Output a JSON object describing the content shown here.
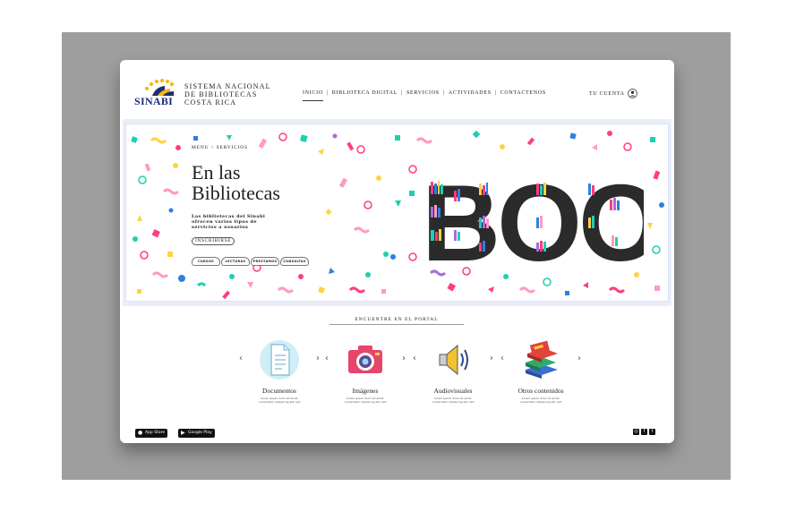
{
  "header": {
    "logo_text": "SINABI",
    "brand_lines": [
      "SISTEMA NACIONAL",
      "DE BIBLIOTECAS",
      "COSTA RICA"
    ],
    "nav": [
      "INICIO",
      "BIBLIOTECA DIGITAL",
      "SERVICIOS",
      "ACTIVIDADES",
      "CONTACTENOS"
    ],
    "nav_separators": [
      "|",
      "|",
      "|",
      "|"
    ],
    "account_label": "TU CUENTA",
    "icons": {
      "account": "user-icon",
      "logo": "sinabi-logo"
    }
  },
  "hero": {
    "breadcrumb": "MENU > SERVICIOS",
    "title_line1": "En las",
    "title_line2": "Bibliotecas",
    "description": "Las bibliotecas del Sinabi ofrecen varios tipos de servicios a usuarios",
    "subscribe_label": "INSCRIBIRSE",
    "pills": [
      "CURSOS",
      "LECTURAS",
      "PRESTAMOS",
      "CONSULTAS"
    ],
    "book_word": "BOOK",
    "colors": {
      "accent_pink": "#ff3d7f",
      "accent_teal": "#1ecfb0",
      "accent_blue": "#2f7fe0",
      "accent_yellow": "#ffd23f",
      "accent_purple": "#a86be0"
    }
  },
  "portal": {
    "title": "ENCUENTRE EN EL PORTAL",
    "items": [
      {
        "title": "Documentos",
        "desc1": "Lorem ipsum dolor sit amet,",
        "desc2": "consectetur adipiscing elit, sed",
        "icon": "document-icon"
      },
      {
        "title": "Imágenes",
        "desc1": "Lorem ipsum dolor sit amet,",
        "desc2": "consectetur adipiscing elit, sed",
        "icon": "camera-icon"
      },
      {
        "title": "Audiovisuales",
        "desc1": "Lorem ipsum dolor sit amet,",
        "desc2": "consectetur adipiscing elit, sed",
        "icon": "speaker-icon"
      },
      {
        "title": "Otros contenidos",
        "desc1": "Lorem ipsum dolor sit amet,",
        "desc2": "consectetur adipiscing elit, sed",
        "icon": "books-icon"
      }
    ],
    "arrow_left": "‹",
    "arrow_right": "›"
  },
  "footer": {
    "app_store": "App Store",
    "google_play": "Google Play",
    "social": [
      "◎",
      "f",
      "t"
    ]
  }
}
